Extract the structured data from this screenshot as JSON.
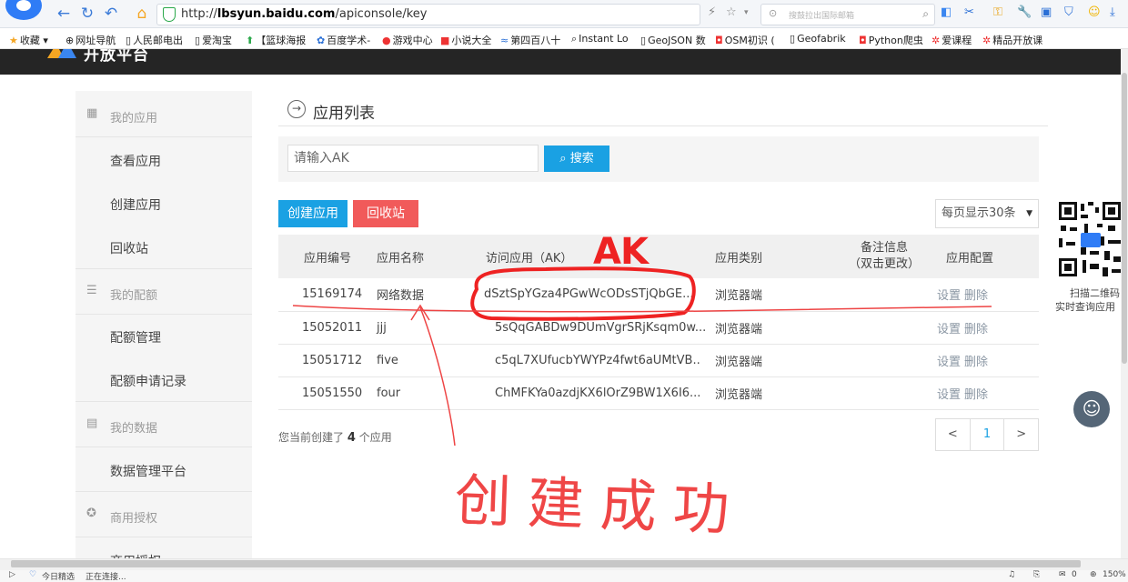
{
  "browser": {
    "url_prefix": "http://",
    "url_domain": "lbsyun.baidu.com",
    "url_path": "/apiconsole/key",
    "search_placeholder": "搜鼓拉出国际邮箱",
    "bookmarks": [
      "收藏",
      "网址导航",
      "人民邮电出",
      "爱淘宝",
      "【篮球海报",
      "百度学术-",
      "游戏中心",
      "小说大全",
      "第四百八十",
      "Instant Lo",
      "GeoJSON 数",
      "OSM初识 (",
      "Geofabrik",
      "Python爬虫",
      "爱课程",
      "精品开放课"
    ],
    "zoom": "150%",
    "status_left": "今日精选",
    "status_text": "正在连接...",
    "status_count": "0"
  },
  "site": {
    "logo_text": "开放平台"
  },
  "sidebar": {
    "groups": [
      {
        "label": "我的应用",
        "icon": "grid-icon"
      },
      {
        "label": "我的配额",
        "icon": "list-icon"
      },
      {
        "label": "我的数据",
        "icon": "id-card-icon"
      },
      {
        "label": "商用授权",
        "icon": "badge-icon"
      }
    ],
    "items": [
      "查看应用",
      "创建应用",
      "回收站",
      "配额管理",
      "配额申请记录",
      "数据管理平台",
      "商用授权"
    ]
  },
  "main": {
    "title": "应用列表",
    "search_placeholder": "请输入AK",
    "search_button": "搜索",
    "create_button": "创建应用",
    "recycle_button": "回收站",
    "per_page": "每页显示30条",
    "columns": {
      "id": "应用编号",
      "name": "应用名称",
      "ak": "访问应用（AK）",
      "type": "应用类别",
      "remark_line1": "备注信息",
      "remark_line2": "（双击更改）",
      "config": "应用配置"
    },
    "rows": [
      {
        "id": "15169174",
        "name": "网络数据",
        "ak": "dSztSpYGza4PGwWcODsSTjQbGE...",
        "type": "浏览器端",
        "settings": "设置",
        "delete": "删除"
      },
      {
        "id": "15052011",
        "name": "jjj",
        "ak": "5sQqGABDw9DUmVgrSRjKsqm0w...",
        "type": "浏览器端",
        "settings": "设置",
        "delete": "删除"
      },
      {
        "id": "15051712",
        "name": "five",
        "ak": "c5qL7XUfucbYWYPz4fwt6aUMtVB..",
        "type": "浏览器端",
        "settings": "设置",
        "delete": "删除"
      },
      {
        "id": "15051550",
        "name": "four",
        "ak": "ChMFKYa0azdjKX6lOrZ9BW1X6I6...",
        "type": "浏览器端",
        "settings": "设置",
        "delete": "删除"
      }
    ],
    "footer_prefix": "您当前创建了",
    "footer_count": "4",
    "footer_suffix": "个应用",
    "pager": {
      "prev": "<",
      "page": "1",
      "next": ">"
    }
  },
  "qr": {
    "line1": "扫描二维码",
    "line2": "实时查询应用"
  },
  "annotation": {
    "label": "AK",
    "handwriting": "创建成功",
    "color": "#ee2222"
  }
}
